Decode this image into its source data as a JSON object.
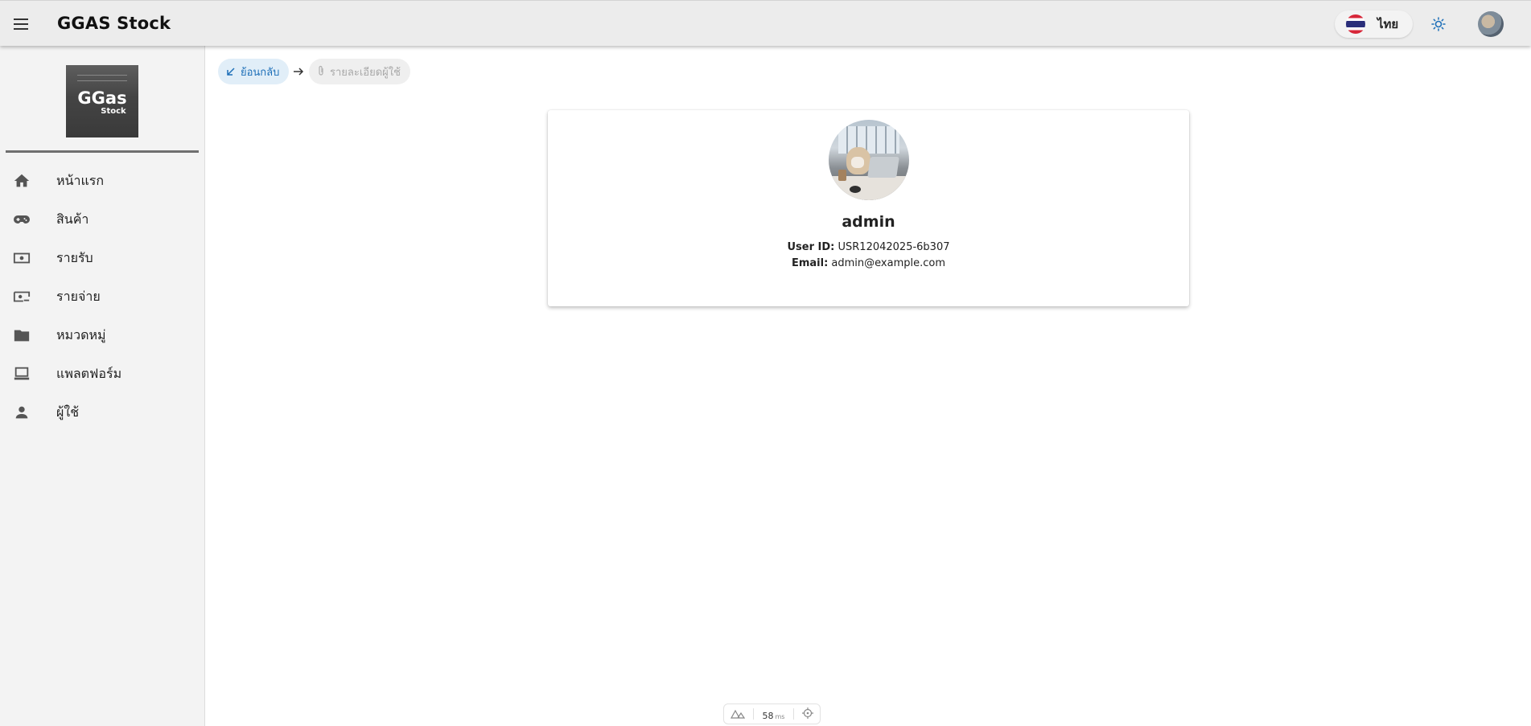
{
  "header": {
    "title": "GGAS Stock",
    "menu_icon": "hamburger-menu-icon",
    "language": {
      "label": "ไทย",
      "flag": "thailand-flag-icon"
    },
    "theme_icon": "sun-icon",
    "avatar_icon": "user-avatar"
  },
  "sidebar": {
    "logo": {
      "main": "GGas",
      "sub": "Stock"
    },
    "items": [
      {
        "label": "หน้าแรก",
        "icon": "home-icon"
      },
      {
        "label": "สินค้า",
        "icon": "gamepad-icon"
      },
      {
        "label": "รายรับ",
        "icon": "cash-icon"
      },
      {
        "label": "รายจ่าย",
        "icon": "cash-remove-icon"
      },
      {
        "label": "หมวดหมู่",
        "icon": "folder-icon"
      },
      {
        "label": "แพลตฟอร์ม",
        "icon": "laptop-icon"
      },
      {
        "label": "ผู้ใช้",
        "icon": "person-icon"
      }
    ]
  },
  "breadcrumb": {
    "back_label": "ย้อนกลับ",
    "current_label": "รายละเอียดผู้ใช้"
  },
  "profile": {
    "username": "admin",
    "user_id_label": "User ID:",
    "user_id": "USR12042025-6b307",
    "email_label": "Email:",
    "email": "admin@example.com"
  },
  "perf": {
    "value": "58",
    "unit": "ms"
  },
  "colors": {
    "appbar": "#ececec",
    "sidebar": "#f3f3f3",
    "accent": "#1d6fb8",
    "back_chip": "#e1eef8"
  }
}
